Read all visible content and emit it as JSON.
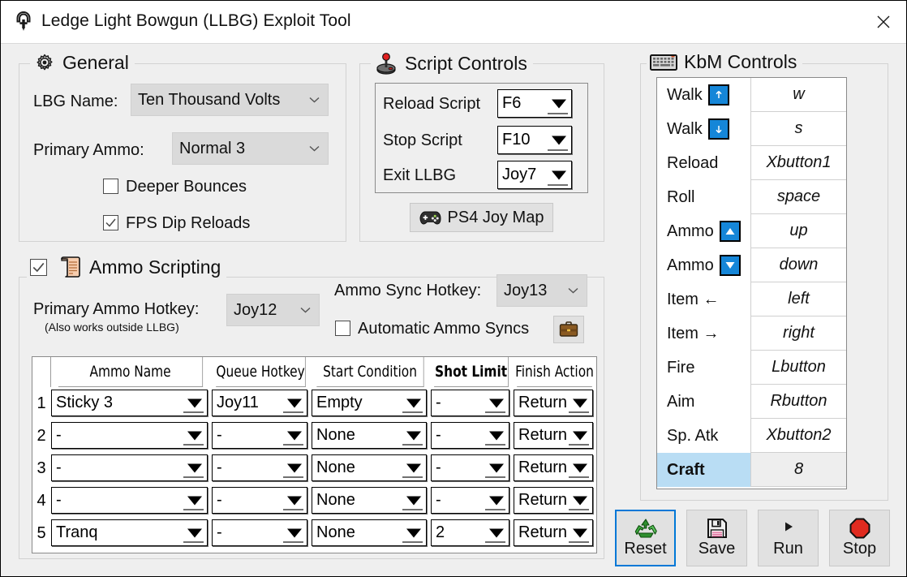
{
  "window": {
    "title": "Ledge Light Bowgun (LLBG) Exploit Tool",
    "icon": "bowgun-icon",
    "close_label": "close-icon"
  },
  "general": {
    "title": "General",
    "icon": "gear-icon",
    "lbg_name_label": "LBG Name:",
    "lbg_name_value": "Ten Thousand Volts",
    "primary_ammo_label": "Primary Ammo:",
    "primary_ammo_value": "Normal 3",
    "deeper_bounces_label": "Deeper Bounces",
    "deeper_bounces_checked": false,
    "fps_dip_label": "FPS Dip Reloads",
    "fps_dip_checked": true
  },
  "script_controls": {
    "title": "Script Controls",
    "icon": "joystick-icon",
    "rows": [
      {
        "label": "Reload Script",
        "value": "F6"
      },
      {
        "label": "Stop Script",
        "value": "F10"
      },
      {
        "label": "Exit LLBG",
        "value": "Joy7"
      }
    ],
    "joymap_button": "PS4 Joy Map",
    "joymap_icon": "gamepad-icon"
  },
  "kbm_controls": {
    "title": "KbM Controls",
    "icon": "keyboard-icon",
    "rows": [
      {
        "action": "Walk",
        "badge": "arrow-up-thin-icon",
        "key": "w",
        "selected": false
      },
      {
        "action": "Walk",
        "badge": "arrow-down-thin-icon",
        "key": "s",
        "selected": false
      },
      {
        "action": "Reload",
        "badge": "",
        "key": "Xbutton1",
        "selected": false
      },
      {
        "action": "Roll",
        "badge": "",
        "key": "space",
        "selected": false
      },
      {
        "action": "Ammo",
        "badge": "triangle-up-icon",
        "key": "up",
        "selected": false
      },
      {
        "action": "Ammo",
        "badge": "triangle-down-icon",
        "key": "down",
        "selected": false
      },
      {
        "action": "Item ←",
        "badge": "",
        "key": "left",
        "selected": false
      },
      {
        "action": "Item →",
        "badge": "",
        "key": "right",
        "selected": false
      },
      {
        "action": "Fire",
        "badge": "",
        "key": "Lbutton",
        "selected": false
      },
      {
        "action": "Aim",
        "badge": "",
        "key": "Rbutton",
        "selected": false
      },
      {
        "action": "Sp. Atk",
        "badge": "",
        "key": "Xbutton2",
        "selected": false
      },
      {
        "action": "Craft",
        "badge": "",
        "key": "8",
        "selected": true
      }
    ]
  },
  "ammo_scripting": {
    "title": "Ammo Scripting",
    "icon": "scroll-icon",
    "enabled": true,
    "primary_hotkey_label": "Primary Ammo Hotkey:",
    "primary_hotkey_note": "(Also works outside LLBG)",
    "primary_hotkey_value": "Joy12",
    "sync_hotkey_label": "Ammo Sync Hotkey:",
    "sync_hotkey_value": "Joy13",
    "auto_sync_label": "Automatic Ammo Syncs",
    "auto_sync_checked": false,
    "auto_sync_button_icon": "briefcase-icon",
    "table": {
      "columns": [
        "Ammo Name",
        "Queue Hotkey",
        "Start Condition",
        "Shot Limit",
        "Finish Action"
      ],
      "bold_columns": [
        "Shot Limit"
      ],
      "rows": [
        {
          "n": "1",
          "ammo_name": "Sticky 3",
          "queue_hotkey": "Joy11",
          "start_condition": "Empty",
          "shot_limit": "-",
          "finish_action": "Return"
        },
        {
          "n": "2",
          "ammo_name": "-",
          "queue_hotkey": "-",
          "start_condition": "None",
          "shot_limit": "-",
          "finish_action": "Return"
        },
        {
          "n": "3",
          "ammo_name": "-",
          "queue_hotkey": "-",
          "start_condition": "None",
          "shot_limit": "-",
          "finish_action": "Return"
        },
        {
          "n": "4",
          "ammo_name": "-",
          "queue_hotkey": "-",
          "start_condition": "None",
          "shot_limit": "-",
          "finish_action": "Return"
        },
        {
          "n": "5",
          "ammo_name": "Tranq",
          "queue_hotkey": "-",
          "start_condition": "None",
          "shot_limit": "2",
          "finish_action": "Return"
        }
      ]
    }
  },
  "actions": [
    {
      "label": "Reset",
      "icon": "recycle-icon",
      "focused": true
    },
    {
      "label": "Save",
      "icon": "floppy-disk-icon",
      "focused": false
    },
    {
      "label": "Run",
      "icon": "play-icon",
      "focused": false
    },
    {
      "label": "Stop",
      "icon": "stop-octagon-icon",
      "focused": false
    }
  ],
  "colors": {
    "background": "#efefef",
    "accent": "#0078d7",
    "badge_blue": "#1586d8",
    "selection": "#b9ddf4",
    "stop_red": "#e02b20"
  }
}
